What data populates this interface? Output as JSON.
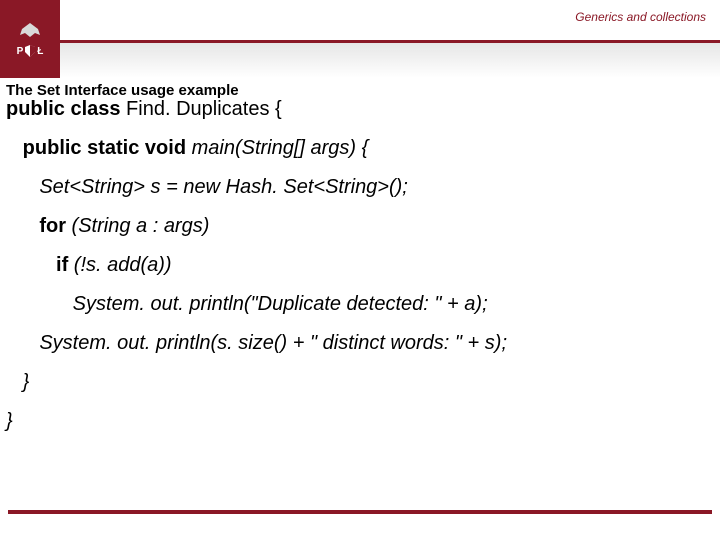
{
  "header": {
    "topic": "Generics and collections",
    "logo_letters_left": "P",
    "logo_letters_right": "Ł"
  },
  "slide": {
    "title": "The Set Interface usage example"
  },
  "code": {
    "l0_a": "public class",
    "l0_b": " Find. Duplicates {",
    "l1_a": "   public static void",
    "l1_b": " main(String[] args) {",
    "l2": "      Set<String> s = new Hash. Set<String>();",
    "l3_a": "      for",
    "l3_b": " (String a : args)",
    "l4_a": "         if",
    "l4_b": " (!s. add(a))",
    "l5": "            System. out. println(\"Duplicate detected: \" + a);",
    "l6": "      System. out. println(s. size() + \" distinct words: \" + s);",
    "l7": "   }",
    "l8": "}"
  }
}
